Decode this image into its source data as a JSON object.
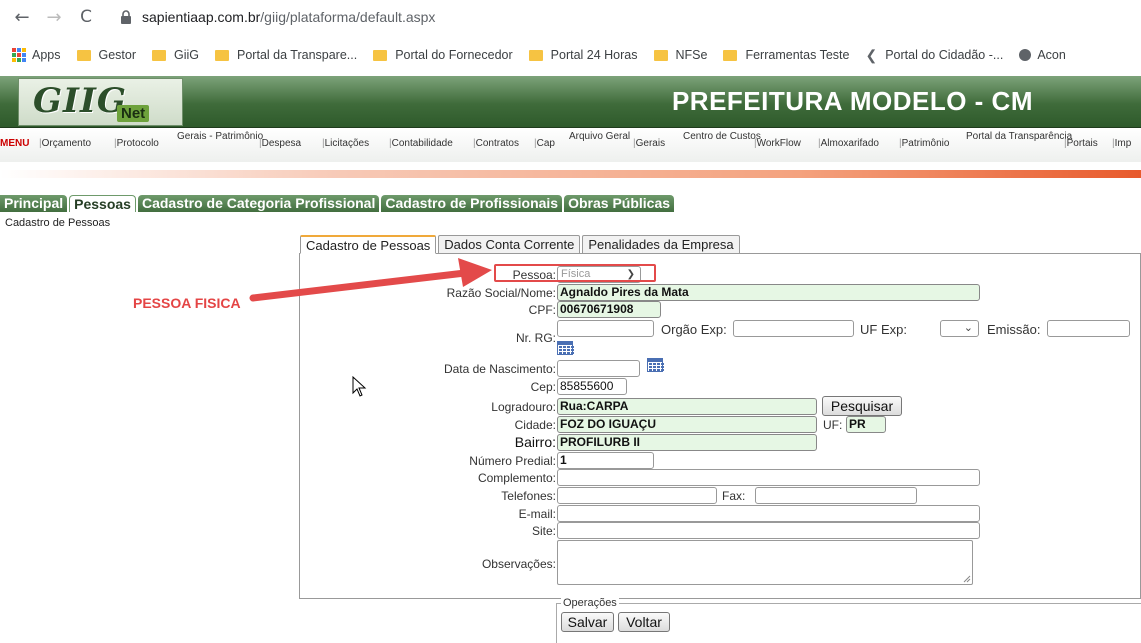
{
  "browser": {
    "url_host": "sapientiaap.com.br",
    "url_path": "/giig/plataforma/default.aspx",
    "back_glyph": "←",
    "forward_glyph": "→",
    "reload_glyph": "C"
  },
  "bookmarks": {
    "apps": "Apps",
    "items": [
      "Gestor",
      "GiiG",
      "Portal da Transpare...",
      "Portal do Fornecedor",
      "Portal 24 Horas",
      "NFSe",
      "Ferramentas Teste",
      "Portal do Cidadão -...",
      "Acon"
    ]
  },
  "header": {
    "logo_main": "GIIG",
    "logo_sub": "Net",
    "title": "PREFEITURA MODELO - CM"
  },
  "menu": {
    "menu_label": "MENU",
    "items": [
      "Orçamento",
      "Protocolo",
      "Gerais - Patrimônio",
      "Despesa",
      "Licitações",
      "Contabilidade",
      "Contratos",
      "Cap",
      "Arquivo Geral",
      "Gerais",
      "Centro de Custos",
      "WorkFlow",
      "Almoxarifado",
      "Patrimônio",
      "Portal da Transparência",
      "Portais",
      "Imp"
    ]
  },
  "module_tabs": [
    "Principal",
    "Pessoas",
    "Cadastro de Categoria Profissional",
    "Cadastro de Profissionais",
    "Obras Públicas"
  ],
  "breadcrumb": "Cadastro de Pessoas",
  "form_tabs": [
    "Cadastro de Pessoas",
    "Dados Conta Corrente",
    "Penalidades da Empresa"
  ],
  "form": {
    "pessoa_label": "Pessoa:",
    "pessoa_value": "Física",
    "razao_label": "Razão Social/Nome:",
    "razao_value": "Agnaldo Pires da Mata",
    "cpf_label": "CPF:",
    "cpf_value": "00670671908",
    "rg_label": "Nr. RG:",
    "rg_value": "",
    "orgao_label": "Orgão Exp:",
    "uf_exp_label": "UF Exp:",
    "emissao_label": "Emissão:",
    "nasc_label": "Data de Nascimento:",
    "cep_label": "Cep:",
    "cep_value": "85855600",
    "logradouro_label": "Logradouro:",
    "logradouro_value": "Rua:CARPA",
    "pesquisar_label": "Pesquisar",
    "cidade_label": "Cidade:",
    "cidade_value": "FOZ DO IGUAÇU",
    "uf_label": "UF:",
    "uf_value": "PR",
    "bairro_label": "Bairro:",
    "bairro_value": "PROFILURB II",
    "numero_label": "Número Predial:",
    "numero_value": "1",
    "complemento_label": "Complemento:",
    "telefones_label": "Telefones:",
    "fax_label": "Fax:",
    "email_label": "E-mail:",
    "site_label": "Site:",
    "obs_label": "Observações:"
  },
  "operations": {
    "legend": "Operações",
    "save": "Salvar",
    "back": "Voltar"
  },
  "annotation": {
    "label": "PESSOA FISICA",
    "color": "#e34a4a"
  },
  "colors": {
    "header_green": "#3f6b3a",
    "field_green": "#e6f7e4",
    "accent_orange": "#e85a2c"
  }
}
